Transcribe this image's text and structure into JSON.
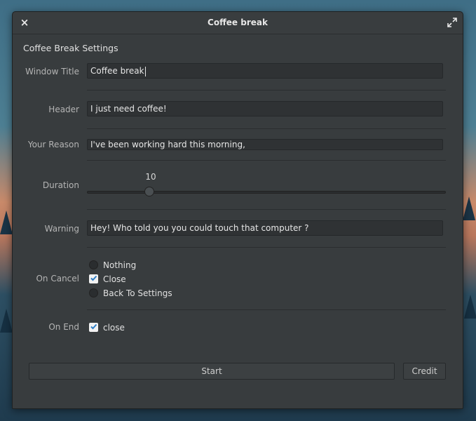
{
  "window": {
    "title": "Coffee break",
    "close_glyph": "×",
    "max_icon": "maximize-icon"
  },
  "settings": {
    "section_title": "Coffee Break Settings",
    "window_title": {
      "label": "Window Title",
      "value": "Coffee break"
    },
    "header": {
      "label": "Header",
      "value": "I just need coffee!"
    },
    "reason": {
      "label": "Your Reason",
      "value": "I've been working hard this morning,"
    },
    "duration": {
      "label": "Duration",
      "value": "10",
      "fraction": 0.18
    },
    "warning": {
      "label": "Warning",
      "value": "Hey! Who told you you could touch that computer ?"
    },
    "on_cancel": {
      "label": "On Cancel",
      "options": [
        "Nothing",
        "Close",
        "Back To Settings"
      ],
      "selected": "Close"
    },
    "on_end": {
      "label": "On End",
      "checkbox_label": "close",
      "checked": true
    }
  },
  "buttons": {
    "start": "Start",
    "credit": "Credit"
  },
  "colors": {
    "accent_check": "#2f7fc7",
    "window_bg": "#383c3e"
  }
}
